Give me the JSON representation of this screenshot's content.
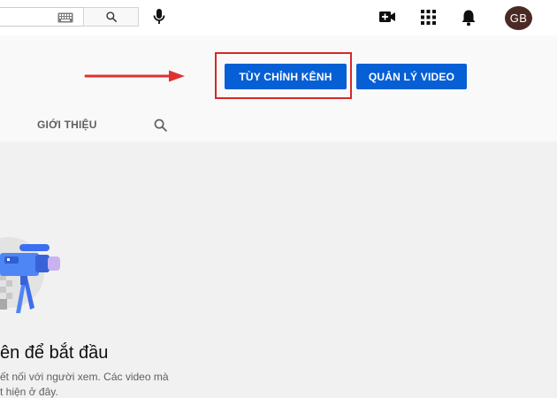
{
  "masthead": {
    "search_placeholder": "",
    "avatar_initials": "GB"
  },
  "channel": {
    "customize_label": "TÙY CHỈNH KÊNH",
    "manage_label": "QUẢN LÝ VIDEO",
    "tabs": [
      {
        "label": "GIỚI THIỆU"
      }
    ]
  },
  "empty_state": {
    "title": "ên để bắt đầu",
    "desc_line1": "ết nối với người xem. Các video mà",
    "desc_line2": "t hiện ở đây."
  },
  "colors": {
    "primary_button": "#065fd4",
    "highlight": "#d62828",
    "avatar_bg": "#4b2a25"
  },
  "icons": [
    "keyboard-icon",
    "search-icon",
    "mic-icon",
    "create-video-icon",
    "apps-icon",
    "bell-icon",
    "arrow-icon"
  ]
}
